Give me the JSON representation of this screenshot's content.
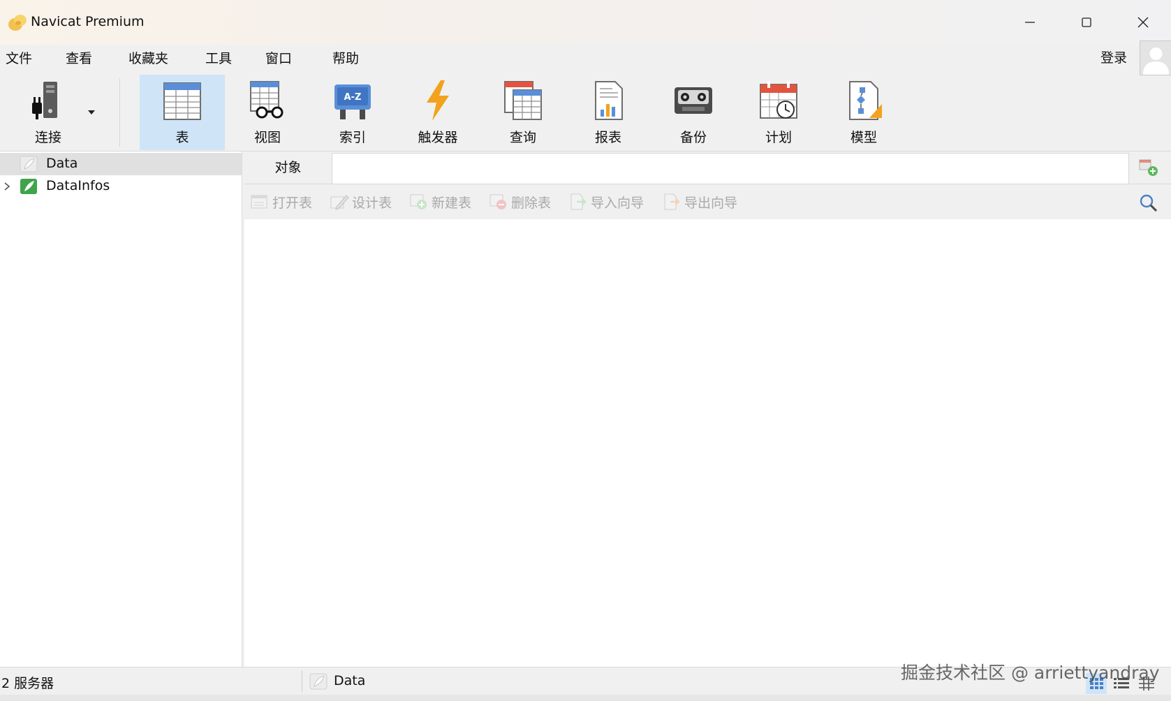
{
  "window": {
    "title": "Navicat Premium",
    "controls": {
      "minimize": "minimize",
      "maximize": "maximize",
      "close": "close"
    }
  },
  "menu": {
    "items": [
      "文件",
      "查看",
      "收藏夹",
      "工具",
      "窗口",
      "帮助"
    ],
    "login": "登录"
  },
  "toolbar": {
    "items": [
      {
        "label": "连接",
        "icon": "connection-icon"
      },
      {
        "label": "表",
        "icon": "table-icon",
        "active": true
      },
      {
        "label": "视图",
        "icon": "view-icon"
      },
      {
        "label": "索引",
        "icon": "index-icon"
      },
      {
        "label": "触发器",
        "icon": "trigger-icon"
      },
      {
        "label": "查询",
        "icon": "query-icon"
      },
      {
        "label": "报表",
        "icon": "report-icon"
      },
      {
        "label": "备份",
        "icon": "backup-icon"
      },
      {
        "label": "计划",
        "icon": "schedule-icon"
      },
      {
        "label": "模型",
        "icon": "model-icon"
      }
    ]
  },
  "sidebar": {
    "connections": [
      {
        "name": "Data",
        "selected": true,
        "expandable": false,
        "connected": false
      },
      {
        "name": "DataInfos",
        "selected": false,
        "expandable": true,
        "connected": true
      }
    ]
  },
  "main": {
    "object_tab": "对象",
    "actions": [
      "打开表",
      "设计表",
      "新建表",
      "删除表",
      "导入向导",
      "导出向导"
    ]
  },
  "status": {
    "servers": "2 服务器",
    "current_db": "Data"
  },
  "watermark": "掘金技术社区 @ arriettyandray",
  "colors": {
    "active_tool_bg": "#cfe4f7",
    "selected_row_bg": "#e0e0e0",
    "disabled_text": "#a9a9a9"
  }
}
